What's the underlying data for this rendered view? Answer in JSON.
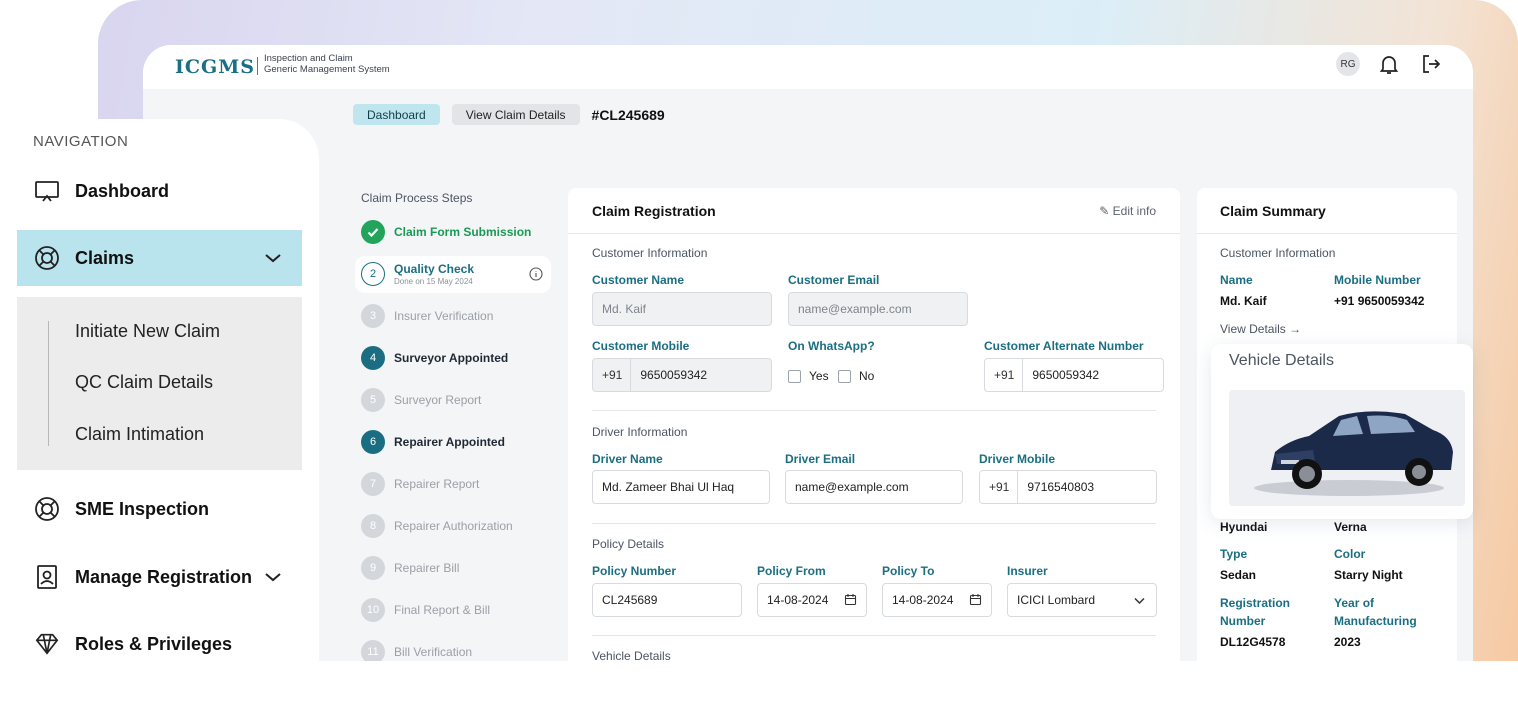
{
  "app": {
    "logo": "ICGMS",
    "subtitle_line1": "Inspection and Claim",
    "subtitle_line2": "Generic Management System",
    "avatar_initials": "RG"
  },
  "breadcrumb": {
    "items": [
      "Dashboard",
      "View Claim Details"
    ],
    "claim_id": "#CL245689"
  },
  "navigation": {
    "title": "NAVIGATION",
    "items": [
      {
        "label": "Dashboard",
        "icon": "monitor-icon"
      },
      {
        "label": "Claims",
        "icon": "lifebuoy-icon",
        "active": true
      },
      {
        "label": "SME Inspection",
        "icon": "lifebuoy-icon"
      },
      {
        "label": "Manage Registration",
        "icon": "id-badge-icon"
      },
      {
        "label": "Roles & Privileges",
        "icon": "diamond-icon"
      }
    ],
    "sub_items": [
      "Initiate New Claim",
      "QC Claim Details",
      "Claim Intimation"
    ]
  },
  "steps": {
    "title": "Claim Process Steps",
    "items": [
      {
        "n": "",
        "label": "Claim Form Submission",
        "state": "ok"
      },
      {
        "n": "2",
        "label": "Quality Check",
        "sub": "Done on 15 May 2024",
        "state": "current"
      },
      {
        "n": "3",
        "label": "Insurer Verification",
        "state": "pending"
      },
      {
        "n": "4",
        "label": "Surveyor Appointed",
        "state": "done"
      },
      {
        "n": "5",
        "label": "Surveyor Report",
        "state": "pending"
      },
      {
        "n": "6",
        "label": "Repairer Appointed",
        "state": "done"
      },
      {
        "n": "7",
        "label": "Repairer Report",
        "state": "pending"
      },
      {
        "n": "8",
        "label": "Repairer Authorization",
        "state": "pending"
      },
      {
        "n": "9",
        "label": "Repairer Bill",
        "state": "pending"
      },
      {
        "n": "10",
        "label": "Final Report & Bill",
        "state": "pending"
      },
      {
        "n": "11",
        "label": "Bill Verification",
        "state": "pending"
      }
    ]
  },
  "registration": {
    "title": "Claim Registration",
    "edit": "Edit info",
    "customer_section": "Customer Information",
    "customer_name_label": "Customer Name",
    "customer_name": "Md. Kaif",
    "customer_email_label": "Customer Email",
    "customer_email_placeholder": "name@example.com",
    "customer_mobile_label": "Customer Mobile",
    "customer_mobile_prefix": "+91",
    "customer_mobile": "9650059342",
    "whatsapp_label": "On WhatsApp?",
    "yes": "Yes",
    "no": "No",
    "alt_label": "Customer Alternate Number",
    "alt_prefix": "+91",
    "alt_number": "9650059342",
    "driver_section": "Driver Information",
    "driver_name_label": "Driver Name",
    "driver_name": "Md. Zameer Bhai Ul Haq",
    "driver_email_label": "Driver Email",
    "driver_email": "name@example.com",
    "driver_mobile_label": "Driver Mobile",
    "driver_mobile_prefix": "+91",
    "driver_mobile": "9716540803",
    "policy_section": "Policy Details",
    "policy_number_label": "Policy Number",
    "policy_number": "CL245689",
    "policy_from_label": "Policy From",
    "policy_from": "14-08-2024",
    "policy_to_label": "Policy To",
    "policy_to": "14-08-2024",
    "insurer_label": "Insurer",
    "insurer": "ICICI Lombard",
    "vehicle_section": "Vehicle Details"
  },
  "summary": {
    "title": "Claim Summary",
    "customer_section": "Customer Information",
    "name_label": "Name",
    "name": "Md. Kaif",
    "mobile_label": "Mobile Number",
    "mobile": "+91 9650059342",
    "view_details": "View Details →",
    "vehicle_title": "Vehicle Details",
    "make": "Hyundai",
    "model": "Verna",
    "type_label": "Type",
    "type": "Sedan",
    "color_label": "Color",
    "color": "Starry Night",
    "reg_label_1": "Registration",
    "reg_label_2": "Number",
    "reg": "DL12G4578",
    "year_label_1": "Year of",
    "year_label_2": "Manufacturing",
    "year": "2023"
  },
  "colors": {
    "accent": "#1b6e82",
    "active_nav": "#b9e3ed",
    "success": "#22a55b"
  }
}
